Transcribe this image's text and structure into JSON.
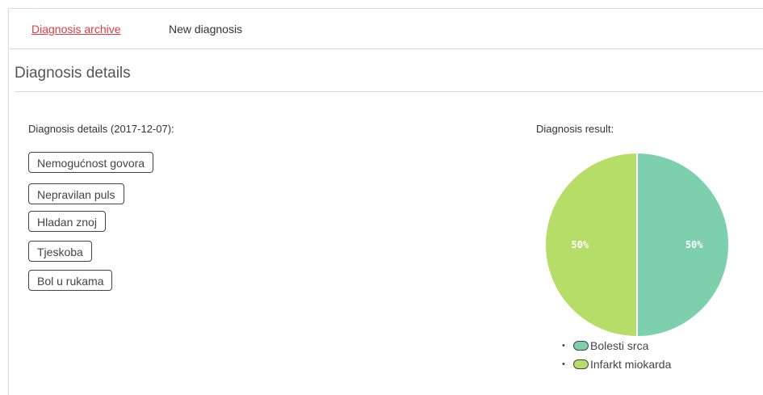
{
  "nav": {
    "archive_label": "Diagnosis archive",
    "new_label": "New diagnosis"
  },
  "page": {
    "section_title": "Diagnosis details",
    "details_heading": "Diagnosis details (2017-12-07):",
    "result_heading": "Diagnosis result:"
  },
  "symptoms": [
    "Nemogućnost govora",
    "Nepravilan puls",
    "Hladan znoj",
    "Tjeskoba",
    "Bol u rukama"
  ],
  "colors": {
    "active_link": "#e7393f",
    "series_1": "#7ecfae",
    "series_2": "#b5dd68"
  },
  "chart_data": {
    "type": "pie",
    "slices": [
      {
        "name": "Bolesti srca",
        "value": 50,
        "label": "50%",
        "color": "#7ecfae"
      },
      {
        "name": "Infarkt miokarda",
        "value": 50,
        "label": "50%",
        "color": "#b5dd68"
      }
    ],
    "legend_placement": "bottom"
  }
}
